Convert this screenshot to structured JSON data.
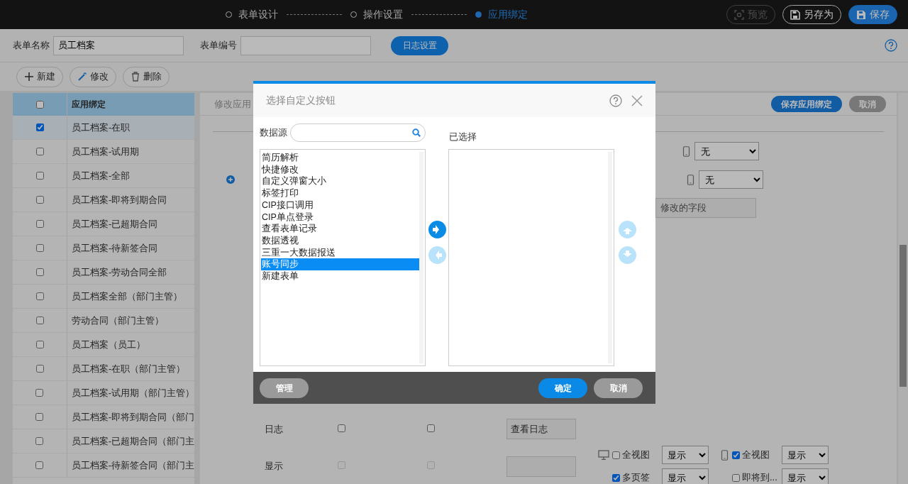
{
  "topbar": {
    "steps": [
      {
        "label": "表单设计",
        "selected": false
      },
      {
        "label": "操作设置",
        "selected": false
      },
      {
        "label": "应用绑定",
        "selected": true
      }
    ],
    "buttons": [
      {
        "label": "预览",
        "kind": "preview",
        "disabled": true
      },
      {
        "label": "另存为",
        "kind": "saveas",
        "disabled": false
      },
      {
        "label": "保存",
        "kind": "save",
        "disabled": false
      }
    ]
  },
  "form": {
    "fields": [
      {
        "label": "表单名称",
        "value": "员工档案"
      },
      {
        "label": "表单编号"
      }
    ],
    "log_button": "日志设置"
  },
  "toolbar": [
    {
      "label": "新建",
      "kind": "add"
    },
    {
      "label": "修改",
      "kind": "edit"
    },
    {
      "label": "删除",
      "kind": "delete"
    }
  ],
  "binding_table": {
    "header": "应用绑定",
    "header_checked": false,
    "rows": [
      {
        "label": "员工档案-在职",
        "checked": true,
        "selected": true
      },
      {
        "label": "员工档案-试用期",
        "checked": false,
        "selected": false
      },
      {
        "label": "员工档案-全部",
        "checked": false,
        "selected": false
      },
      {
        "label": "员工档案-即将到期合同",
        "checked": false,
        "selected": false
      },
      {
        "label": "员工档案-已超期合同",
        "checked": false,
        "selected": false
      },
      {
        "label": "员工档案-待新签合同",
        "checked": false,
        "selected": false
      },
      {
        "label": "员工档案-劳动合同全部",
        "checked": false,
        "selected": false
      },
      {
        "label": "员工档案全部（部门主管）",
        "checked": false,
        "selected": false
      },
      {
        "label": "劳动合同（部门主管）",
        "checked": false,
        "selected": false
      },
      {
        "label": "员工档案（员工）",
        "checked": false,
        "selected": false
      },
      {
        "label": "员工档案-在职（部门主管）",
        "checked": false,
        "selected": false
      },
      {
        "label": "员工档案-试用期（部门主管）",
        "checked": false,
        "selected": false
      },
      {
        "label": "员工档案-即将到期合同（部门",
        "checked": false,
        "selected": false
      },
      {
        "label": "员工档案-已超期合同（部门主",
        "checked": false,
        "selected": false
      },
      {
        "label": "员工档案-待新签合同（部门主",
        "checked": false,
        "selected": false
      }
    ]
  },
  "panel": {
    "title": "修改应用",
    "buttons": [
      {
        "label": "保存应用绑定",
        "kind": "primary"
      },
      {
        "label": "取消",
        "kind": "secondary"
      }
    ],
    "selects": [
      "无",
      "无"
    ],
    "field_value": "修改的字段",
    "rows": [
      {
        "label": "日志",
        "disabled": false,
        "check_1": false,
        "check_2": false,
        "value": "查看日志"
      },
      {
        "label": "显示",
        "disabled": true,
        "check_1": false,
        "check_2": false
      }
    ],
    "view_options": [
      {
        "kind": "desktop",
        "label": "全视图",
        "checked": false,
        "value": "显示"
      },
      {
        "kind": "phone",
        "label": "全视图",
        "checked": true,
        "value": "显示"
      },
      {
        "kind": "plain",
        "label": "多页签",
        "checked": true,
        "value": "显示"
      },
      {
        "kind": "plain",
        "label": "即将到...",
        "checked": false,
        "value": "显示"
      }
    ]
  },
  "modal": {
    "title": "选择自定义按钮",
    "source_label": "数据源",
    "selected_label": "已选择",
    "source_items": [
      {
        "label": "简历解析",
        "selected": false
      },
      {
        "label": "快捷修改",
        "selected": false
      },
      {
        "label": "自定义弹窗大小",
        "selected": false
      },
      {
        "label": "标签打印",
        "selected": false
      },
      {
        "label": "CIP接口调用",
        "selected": false
      },
      {
        "label": "CIP单点登录",
        "selected": false
      },
      {
        "label": "查看表单记录",
        "selected": false
      },
      {
        "label": "数据透视",
        "selected": false
      },
      {
        "label": "三重一大数据报送",
        "selected": false
      },
      {
        "label": "账号同步",
        "selected": true
      },
      {
        "label": "新建表单",
        "selected": false
      }
    ],
    "move_buttons": [
      {
        "kind": "right",
        "disabled": false
      },
      {
        "kind": "left",
        "disabled": true
      }
    ],
    "order_buttons": [
      {
        "kind": "up",
        "disabled": true
      },
      {
        "kind": "down",
        "disabled": true
      }
    ],
    "footer_buttons": [
      {
        "label": "管理",
        "kind": "secondary"
      },
      {
        "label": "确定",
        "kind": "primary"
      },
      {
        "label": "取消",
        "kind": "secondary"
      }
    ]
  }
}
